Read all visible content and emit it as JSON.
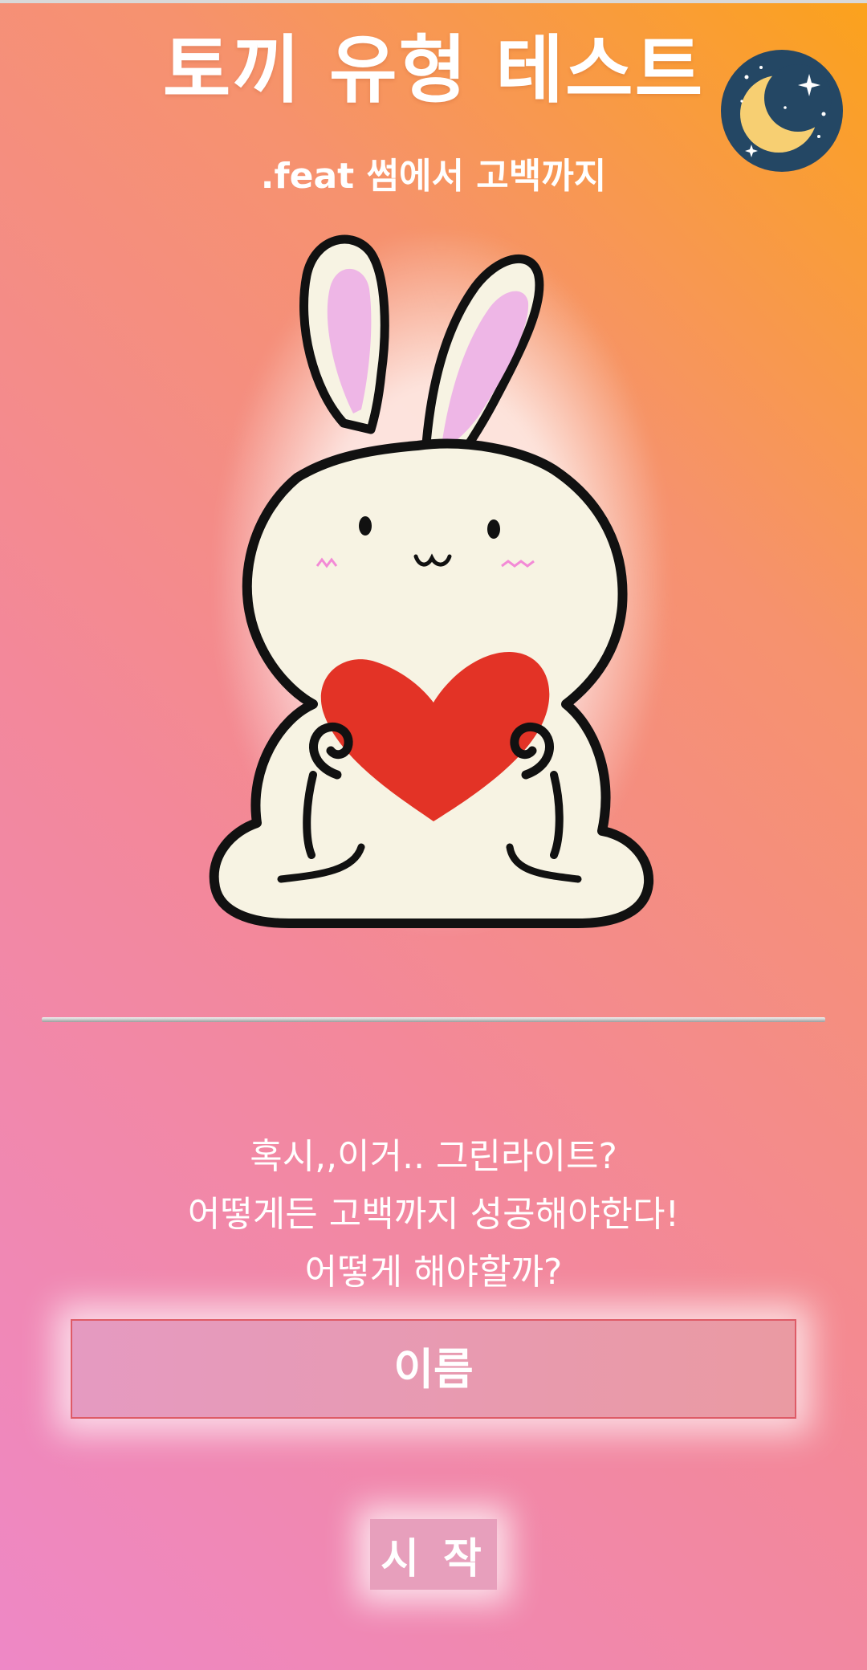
{
  "header": {
    "title": "토끼 유형 테스트",
    "subtitle": ".feat 썸에서 고백까지",
    "theme_toggle_icon": "moon-icon"
  },
  "hero": {
    "image_icon": "bunny-holding-heart-illustration"
  },
  "intro": {
    "lines": [
      "혹시,,이거.. 그린라이트?",
      "어떻게든 고백까지 성공해야한다!",
      "어떻게 해야할까?"
    ]
  },
  "form": {
    "name_placeholder": "이름",
    "name_value": "",
    "start_label": "시 작"
  },
  "colors": {
    "gradient_top_right": "#fba21c",
    "gradient_bottom_left": "#ee88c6",
    "moon_bg": "#244764",
    "moon": "#f7cf72",
    "heart": "#e33326",
    "ear_inner": "#eeb6e6",
    "bunny_body": "#f7f3e3"
  }
}
